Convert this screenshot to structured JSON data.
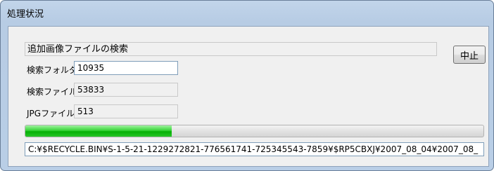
{
  "window": {
    "title": "処理状況"
  },
  "status": {
    "text": "追加画像ファイルの検索"
  },
  "stop_button": {
    "label": "中止"
  },
  "rows": [
    {
      "label": "検索フォルダ数",
      "value": "10935"
    },
    {
      "label": "検索ファイル数",
      "value": "53833"
    },
    {
      "label": "JPGファイル数",
      "value": "513"
    }
  ],
  "progress": {
    "fraction": 0.32,
    "color": "#06b006"
  },
  "current_path": "C:¥$RECYCLE.BIN¥S-1-5-21-1229272821-776561741-725345543-7859¥$RP5CBXJ¥2007_08_04¥2007_08_"
}
